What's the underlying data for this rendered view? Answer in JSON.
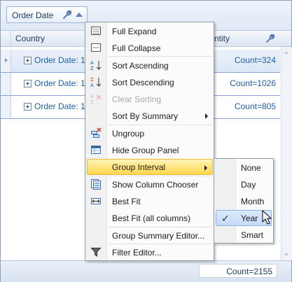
{
  "group_panel": {
    "chip_label": "Order Date",
    "wrench_icon": "wrench-icon",
    "sort_icon": "sort-ascending-arrow-icon"
  },
  "header": {
    "col_country": "Country",
    "col_quantity": "ntity"
  },
  "rows": [
    {
      "text": "Order Date: 1",
      "summary": "Count=324"
    },
    {
      "text": "Order Date: 1",
      "summary": "Count=1026"
    },
    {
      "text": "Order Date: 1",
      "summary": "Count=805"
    }
  ],
  "footer": {
    "total": "Count=2155"
  },
  "menu": {
    "items": [
      {
        "label": "Full Expand",
        "icon": "full-expand-icon"
      },
      {
        "label": "Full Collapse",
        "icon": "full-collapse-icon"
      },
      {
        "label": "Sort Ascending",
        "icon": "sort-ascending-icon"
      },
      {
        "label": "Sort Descending",
        "icon": "sort-descending-icon"
      },
      {
        "label": "Clear Sorting",
        "icon": "clear-sorting-icon",
        "disabled": true
      },
      {
        "label": "Sort By Summary",
        "submenu": true
      },
      {
        "label": "Ungroup",
        "icon": "ungroup-icon"
      },
      {
        "label": "Hide Group Panel",
        "icon": "hide-group-panel-icon"
      },
      {
        "label": "Group Interval",
        "submenu": true,
        "highlighted": true
      },
      {
        "label": "Show Column Chooser",
        "icon": "column-chooser-icon"
      },
      {
        "label": "Best Fit",
        "icon": "best-fit-icon"
      },
      {
        "label": "Best Fit (all columns)"
      },
      {
        "label": "Group Summary Editor..."
      },
      {
        "label": "Filter Editor...",
        "icon": "filter-icon"
      }
    ]
  },
  "submenu": {
    "items": [
      {
        "label": "None"
      },
      {
        "label": "Day"
      },
      {
        "label": "Month"
      },
      {
        "label": "Year",
        "checked": true,
        "highlighted": true
      },
      {
        "label": "Smart"
      }
    ]
  },
  "colors": {
    "accent_link": "#1e5fa8",
    "menu_highlight": "#ffd64d",
    "submenu_highlight": "#c3dbf7",
    "row_divider": "#8ba0d6"
  }
}
